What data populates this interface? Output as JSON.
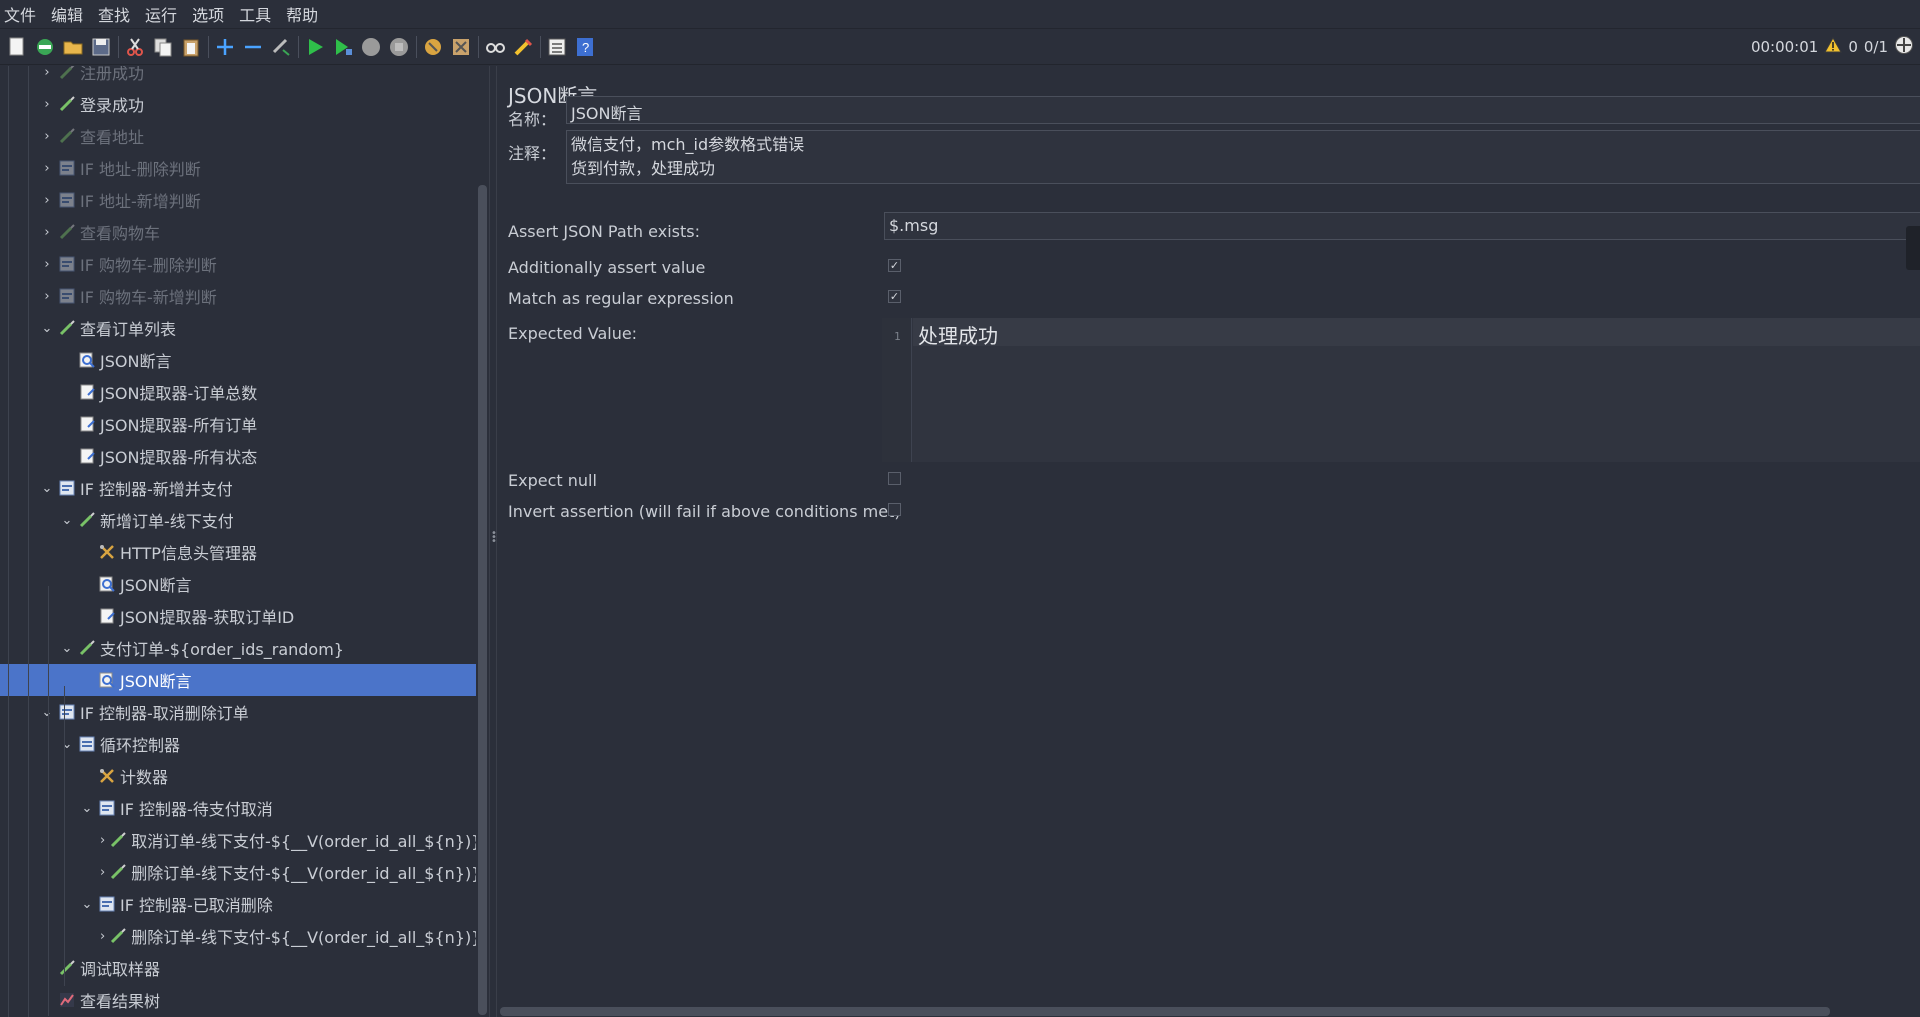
{
  "menu": [
    "文件",
    "编辑",
    "查找",
    "运行",
    "选项",
    "工具",
    "帮助"
  ],
  "toolbar": {
    "buttons": [
      "new-icon",
      "templates-icon",
      "open-icon",
      "save-icon",
      "cut-icon",
      "copy-icon",
      "paste-icon",
      "expand-icon",
      "collapse-icon",
      "toggle-icon",
      "start-icon",
      "start-no-pause-icon",
      "stop-icon",
      "shutdown-icon",
      "clear-icon",
      "clear-all-icon",
      "search-icon",
      "reset-search-icon",
      "function-helper-icon",
      "help-icon"
    ],
    "timer": "00:00:01",
    "warning_count": "0",
    "thread_ratio": "0/1"
  },
  "tree": [
    {
      "label": "注册成功",
      "icon": "sampler-icon",
      "chev": "›",
      "disabled": true
    },
    {
      "label": "登录成功",
      "icon": "sampler-icon",
      "chev": "›",
      "disabled": false
    },
    {
      "label": "查看地址",
      "icon": "sampler-icon",
      "chev": "›",
      "disabled": true
    },
    {
      "label": "IF 地址-删除判断",
      "icon": "if-controller-icon",
      "chev": "›",
      "disabled": true
    },
    {
      "label": "IF 地址-新增判断",
      "icon": "if-controller-icon",
      "chev": "›",
      "disabled": true
    },
    {
      "label": "查看购物车",
      "icon": "sampler-icon",
      "chev": "›",
      "disabled": true
    },
    {
      "label": "IF 购物车-删除判断",
      "icon": "if-controller-icon",
      "chev": "›",
      "disabled": true
    },
    {
      "label": "IF 购物车-新增判断",
      "icon": "if-controller-icon",
      "chev": "›",
      "disabled": true
    },
    {
      "label": "查看订单列表",
      "icon": "sampler-icon",
      "chev": "⌄",
      "disabled": false
    },
    {
      "label": "JSON断言",
      "icon": "assertion-icon",
      "chev": "",
      "disabled": false
    },
    {
      "label": "JSON提取器-订单总数",
      "icon": "extractor-icon",
      "chev": "",
      "disabled": false
    },
    {
      "label": "JSON提取器-所有订单",
      "icon": "extractor-icon",
      "chev": "",
      "disabled": false
    },
    {
      "label": "JSON提取器-所有状态",
      "icon": "extractor-icon",
      "chev": "",
      "disabled": false
    },
    {
      "label": "IF 控制器-新增并支付",
      "icon": "if-controller-icon",
      "chev": "⌄",
      "disabled": false
    },
    {
      "label": "新增订单-线下支付",
      "icon": "sampler-icon",
      "chev": "⌄",
      "disabled": false
    },
    {
      "label": "HTTP信息头管理器",
      "icon": "config-icon",
      "chev": "",
      "disabled": false
    },
    {
      "label": "JSON断言",
      "icon": "assertion-icon",
      "chev": "",
      "disabled": false
    },
    {
      "label": "JSON提取器-获取订单ID",
      "icon": "extractor-icon",
      "chev": "",
      "disabled": false
    },
    {
      "label": "支付订单-${order_ids_random}",
      "icon": "sampler-icon",
      "chev": "⌄",
      "disabled": false
    },
    {
      "label": "JSON断言",
      "icon": "assertion-icon",
      "chev": "",
      "disabled": false,
      "selected": true
    },
    {
      "label": "IF 控制器-取消删除订单",
      "icon": "if-controller-icon",
      "chev": "⌄",
      "disabled": false
    },
    {
      "label": "循环控制器",
      "icon": "loop-controller-icon",
      "chev": "⌄",
      "disabled": false
    },
    {
      "label": "计数器",
      "icon": "config-icon",
      "chev": "",
      "disabled": false
    },
    {
      "label": "IF 控制器-待支付取消",
      "icon": "if-controller-icon",
      "chev": "⌄",
      "disabled": false
    },
    {
      "label": "取消订单-线下支付-${__V(order_id_all_${n})}",
      "icon": "sampler-icon",
      "chev": "›",
      "disabled": false
    },
    {
      "label": "删除订单-线下支付-${__V(order_id_all_${n})}",
      "icon": "sampler-icon",
      "chev": "›",
      "disabled": false
    },
    {
      "label": "IF 控制器-已取消删除",
      "icon": "if-controller-icon",
      "chev": "⌄",
      "disabled": false
    },
    {
      "label": "删除订单-线下支付-${__V(order_id_all_${n})}",
      "icon": "sampler-icon",
      "chev": "›",
      "disabled": false
    },
    {
      "label": "调试取样器",
      "icon": "sampler-icon",
      "chev": "",
      "disabled": false
    },
    {
      "label": "查看结果树",
      "icon": "listener-icon",
      "chev": "",
      "disabled": false
    }
  ],
  "editor": {
    "title": "JSON断言",
    "name_label": "名称：",
    "name_value": "JSON断言",
    "comment_label": "注释：",
    "comment_lines": [
      "微信支付，mch_id参数格式错误",
      "货到付款，处理成功"
    ],
    "path_label": "Assert JSON Path exists:",
    "path_value": "$.msg",
    "assert_value_label": "Additionally assert value",
    "assert_value_checked": true,
    "regex_label": "Match as regular expression",
    "regex_checked": true,
    "expected_label": "Expected Value:",
    "expected_line_number": "1",
    "expected_value": "处理成功",
    "expect_null_label": "Expect null",
    "expect_null_checked": false,
    "invert_label": "Invert assertion (will fail if above conditions met)",
    "invert_checked": false
  }
}
